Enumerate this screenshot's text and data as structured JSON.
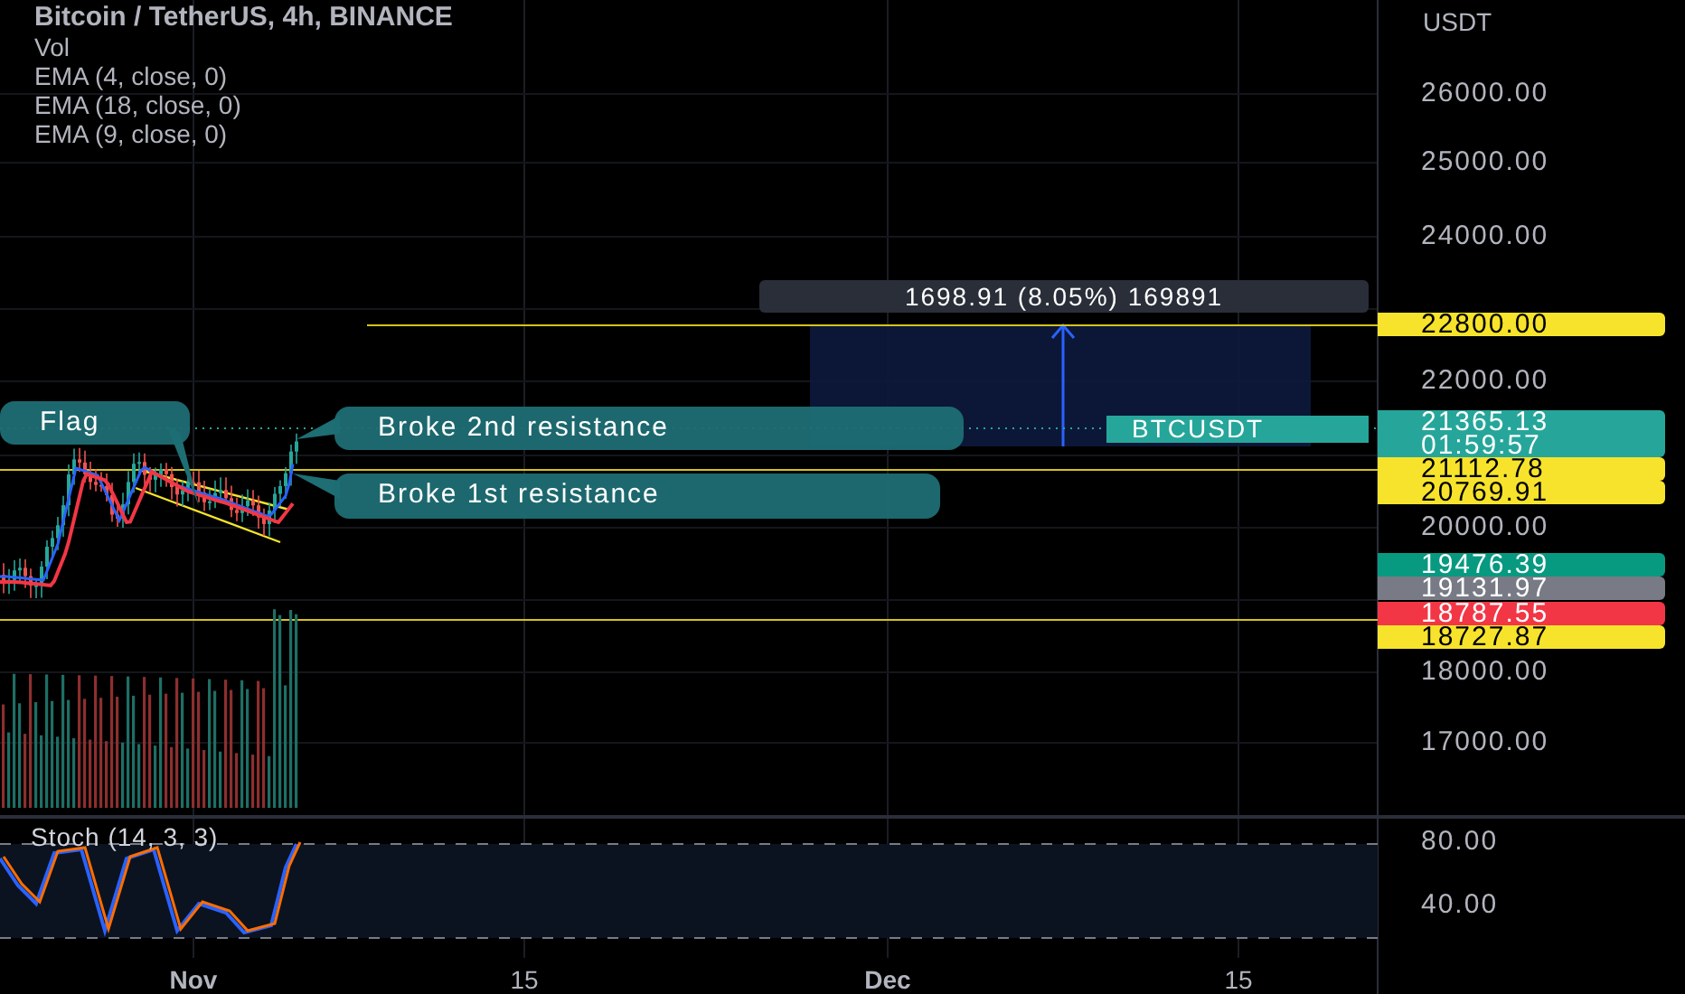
{
  "header": {
    "title": "Bitcoin / TetherUS, 4h, BINANCE",
    "indicators": [
      "Vol",
      "EMA (4, close, 0)",
      "EMA (18, close, 0)",
      "EMA (9, close, 0)"
    ]
  },
  "price_axis": {
    "unit": "USDT",
    "ticks": [
      "26000.00",
      "25000.00",
      "24000.00",
      "22000.00",
      "20000.00",
      "18000.00",
      "17000.00"
    ]
  },
  "price_tags": [
    {
      "text": "22800.00",
      "color": "#f7e32b"
    },
    {
      "text": "21365.13",
      "countdown": "01:59:57",
      "color": "#26a69a"
    },
    {
      "text": "21112.78",
      "color": "#f7e32b"
    },
    {
      "text": "20769.91",
      "color": "#f7e32b"
    },
    {
      "text": "19476.39",
      "color": "#089981"
    },
    {
      "text": "19131.97",
      "color": "#787b86"
    },
    {
      "text": "18787.55",
      "color": "#f23645"
    },
    {
      "text": "18727.87",
      "color": "#f7e32b"
    }
  ],
  "annotations": [
    {
      "text": "Flag"
    },
    {
      "text": "Broke 2nd resistance"
    },
    {
      "text": "Broke 1st resistance"
    }
  ],
  "measure": {
    "label": "1698.91 (8.05%) 169891"
  },
  "symbol_label": "BTCUSDT",
  "stoch": {
    "title": "Stoch (14, 3, 3)",
    "ticks": [
      "80.00",
      "40.00"
    ]
  },
  "time_axis": [
    "Nov",
    "15",
    "Dec",
    "15"
  ]
}
